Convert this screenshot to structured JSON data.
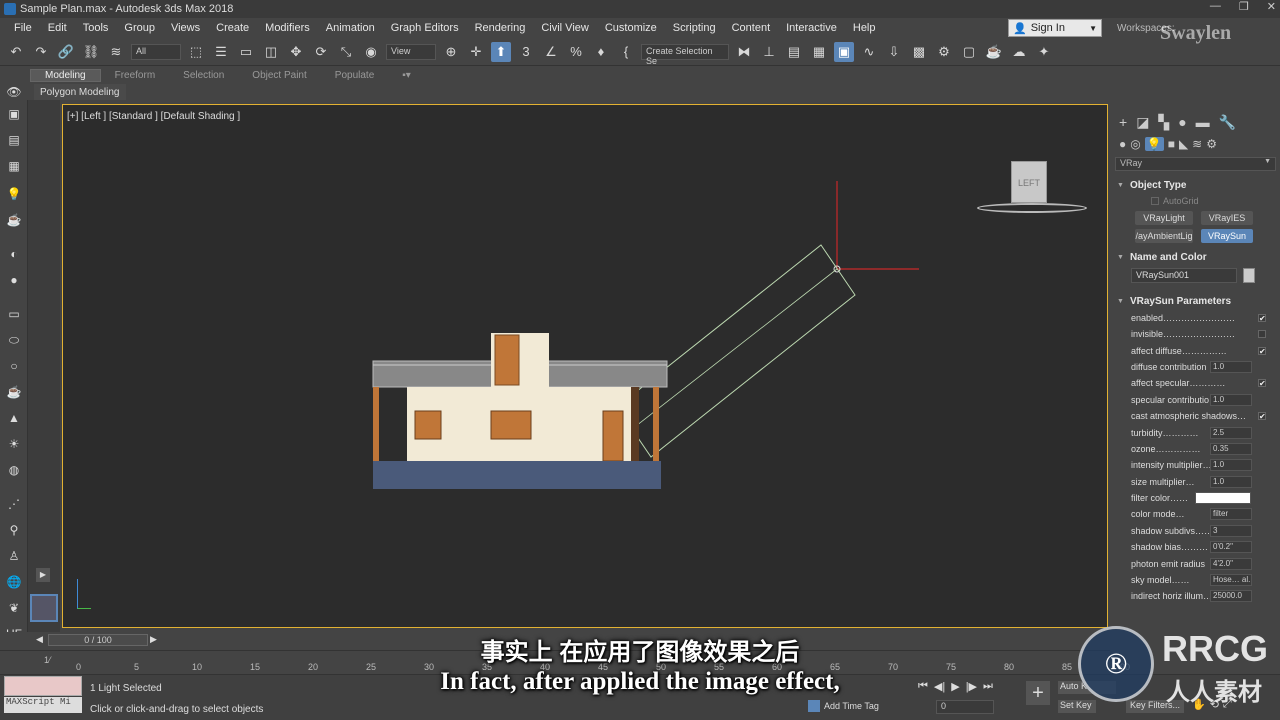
{
  "window": {
    "title": "Sample Plan.max - Autodesk 3ds Max 2018",
    "controls": [
      "—",
      "❐",
      "✕"
    ]
  },
  "menu": [
    "File",
    "Edit",
    "Tools",
    "Group",
    "Views",
    "Create",
    "Modifiers",
    "Animation",
    "Graph Editors",
    "Rendering",
    "Civil View",
    "Customize",
    "Scripting",
    "Content",
    "Interactive",
    "Help"
  ],
  "account": {
    "sign_in": "Sign In",
    "workspaces": "Workspaces:"
  },
  "toolbar": {
    "selection_filter": "All",
    "ref_coord": "View",
    "named_selection": "Create Selection Se"
  },
  "ribbon": {
    "tabs": [
      "Modeling",
      "Freeform",
      "Selection",
      "Object Paint",
      "Populate"
    ],
    "active": "Modeling",
    "panel": "Polygon Modeling"
  },
  "viewport": {
    "label": "[+] [Left ] [Standard ] [Default Shading ]",
    "viewcube_face": "LEFT"
  },
  "command_panel": {
    "renderer": "VRay",
    "object_type": {
      "title": "Object Type",
      "autogrid": "AutoGrid",
      "buttons": [
        "VRayLight",
        "VRayIES",
        "/ayAmbientLig",
        "VRaySun"
      ],
      "active": "VRaySun"
    },
    "name_color": {
      "title": "Name and Color",
      "name": "VRaySun001"
    },
    "params": {
      "title": "VRaySun Parameters",
      "rows": [
        {
          "label": "enabled……………………",
          "check": "✔"
        },
        {
          "label": "invisible……………………",
          "check": ""
        },
        {
          "label": "affect diffuse……………",
          "check": "✔"
        },
        {
          "label": "diffuse contribution",
          "value": "1.0"
        },
        {
          "label": "affect specular…………",
          "check": "✔"
        },
        {
          "label": "specular contributio",
          "value": "1.0"
        },
        {
          "label": "cast atmospheric shadows…",
          "check": "✔"
        },
        {
          "label": "turbidity…………",
          "value": "2.5"
        },
        {
          "label": "ozone……………",
          "value": "0.35"
        },
        {
          "label": "intensity multiplier…",
          "value": "1.0"
        },
        {
          "label": "size multiplier…",
          "value": "1.0"
        },
        {
          "label": "filter color……",
          "value": ""
        },
        {
          "label": "color mode…",
          "value": "filter"
        },
        {
          "label": "shadow subdivs……",
          "value": "3"
        },
        {
          "label": "shadow bias………",
          "value": "0'0.2\""
        },
        {
          "label": "photon emit radius",
          "value": "4'2.0\""
        },
        {
          "label": "sky model……",
          "value": "Hose… al."
        },
        {
          "label": "indirect horiz illum…",
          "value": "25000.0"
        }
      ]
    }
  },
  "timeline": {
    "frame": "0 / 100",
    "ticks": [
      "0",
      "5",
      "10",
      "15",
      "20",
      "25",
      "30",
      "35",
      "40",
      "45",
      "50",
      "55",
      "60",
      "65",
      "70",
      "75",
      "80",
      "85",
      "90"
    ]
  },
  "status": {
    "selection": "1 Light Selected",
    "hint": "Click or click-and-drag to select objects",
    "maxscript": "MAXScript Mi",
    "add_time_tag": "Add Time Tag",
    "frame_field": "0",
    "auto_key": "Auto K",
    "set_key": "Set Key",
    "key_filters": "Key Filters..."
  },
  "subtitles": {
    "zh": "事实上 在应用了图像效果之后",
    "en": "In fact, after applied the image effect,"
  },
  "watermarks": {
    "brand": "RRCG",
    "cn": "人人素材",
    "user": "Swaylen"
  },
  "colors": {
    "viewport_border": "#e3b232",
    "active_blue": "#5b86b8",
    "axis_red": "#c8282a",
    "wall": "#f2ead6",
    "wood": "#c07638"
  }
}
